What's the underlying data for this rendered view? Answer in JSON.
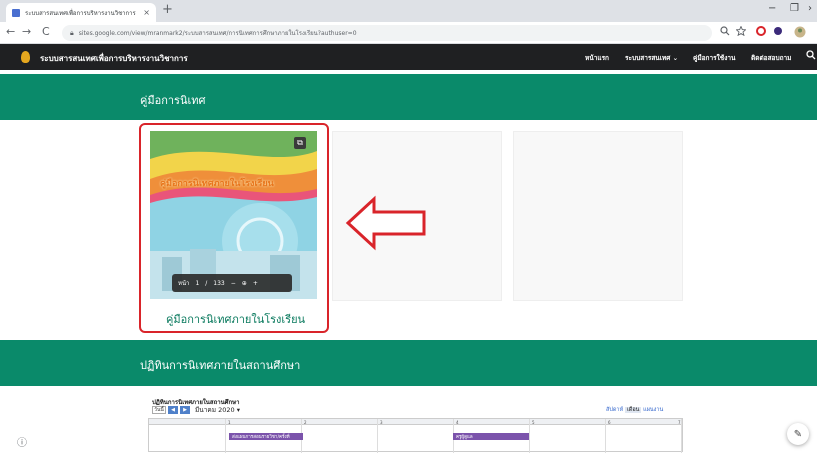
{
  "browser": {
    "tab_title": "ระบบสารสนเทศเพื่อการบริหารงานวิชาการ",
    "tab_close": "×",
    "new_tab": "+",
    "url": "sites.google.com/view/mranmark2/ระบบสารสนเทศ/การนิเทศการศึกษาภายในโรงเรียน?authuser=0",
    "back": "←",
    "forward": "→",
    "reload": "C",
    "window_minimize": "−",
    "window_restore": "❐",
    "window_close": "›"
  },
  "site": {
    "title": "ระบบสารสนเทศเพื่อการบริหารงานวิชาการ",
    "nav": [
      {
        "label": "หน้าแรก"
      },
      {
        "label": "ระบบสารสนเทศ ⌄"
      },
      {
        "label": "คู่มือการใช้งาน"
      },
      {
        "label": "ติดต่อสอบถาม"
      }
    ]
  },
  "section1": {
    "title": "คู่มือการนิเทศ"
  },
  "document": {
    "thumb_title": "คู่มือการนิเทศภายในโรงเรียน",
    "viewer": {
      "page_label": "หน้า",
      "page_current": "1",
      "page_sep": "/",
      "page_total": "133",
      "zoom_out": "−",
      "zoom_icon": "⊕",
      "zoom_in": "+"
    },
    "caption": "คู่มือการนิเทศภายในโรงเรียน"
  },
  "section2": {
    "title": "ปฏิทินการนิเทศภายในสถานศึกษา"
  },
  "calendar": {
    "title": "ปฏิทินการนิเทศภายในสถานศึกษา",
    "today_label": "วันนี้",
    "prev": "◀",
    "next": "▶",
    "month": "มีนาคม 2020",
    "month_caret": "▾",
    "views": {
      "week": "สัปดาห์",
      "month": "เดือน",
      "agenda": "แผนงาน"
    },
    "day_numbers": [
      "1",
      "2",
      "3",
      "4",
      "5",
      "6",
      "7"
    ],
    "events": [
      {
        "label": "ส่งแผนการสอนรายวิชา/ครั้งที่"
      },
      {
        "label": "ครูผู้ดูแล"
      }
    ]
  },
  "colors": {
    "band": "#0a8a6a",
    "header": "#1f2022",
    "highlight": "#d9242a",
    "event": "#7b53ab"
  },
  "icons": {
    "lock": "lock-icon",
    "search": "search-icon",
    "popout": "open-in-new-icon",
    "edit": "pencil-icon",
    "info": "info-icon"
  }
}
